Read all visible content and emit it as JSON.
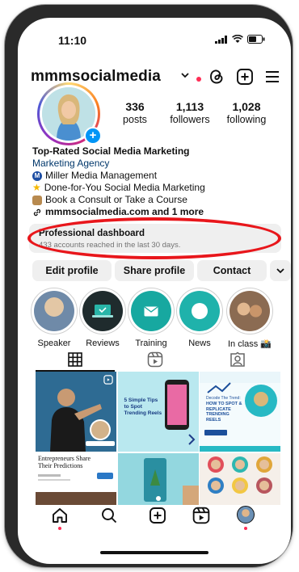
{
  "status_bar": {
    "time": "11:10"
  },
  "header": {
    "username": "mmmsocialmedia"
  },
  "stats": [
    {
      "value": "336",
      "label": "posts"
    },
    {
      "value": "1,113",
      "label": "followers"
    },
    {
      "value": "1,028",
      "label": "following"
    }
  ],
  "bio": {
    "title": "Top-Rated Social Media Marketing",
    "category": "Marketing Agency",
    "lines": [
      "Miller Media Management",
      "Done-for-You Social Media Marketing",
      "Book a Consult or Take a Course"
    ],
    "link": "mmmsocialmedia.com and 1 more"
  },
  "dashboard": {
    "title": "Professional dashboard",
    "subtitle": "433 accounts reached in the last 30 days."
  },
  "buttons": {
    "edit": "Edit profile",
    "share": "Share profile",
    "contact": "Contact"
  },
  "highlights": [
    {
      "label": "Speaker"
    },
    {
      "label": "Reviews"
    },
    {
      "label": "Training"
    },
    {
      "label": "News"
    },
    {
      "label": "In class 📸"
    }
  ],
  "posts": {
    "p2_text": "5 Simple Tips to Spot Trending Reels",
    "p3_title": "HOW TO SPOT & REPLICATE TRENDING REELS",
    "p3_pre": "Decode The Trend:",
    "p4_text": "Entrepreneurs Share Their Predictions"
  },
  "colors": {
    "accent": "#0095f6",
    "annotation": "#e8161b",
    "link": "#00376b"
  },
  "icons": [
    "threads-icon",
    "create-plus-icon",
    "menu-icon",
    "grid-icon",
    "reels-icon",
    "tagged-icon",
    "home-icon",
    "search-icon",
    "create-icon",
    "reels-nav-icon",
    "profile-avatar-icon"
  ]
}
